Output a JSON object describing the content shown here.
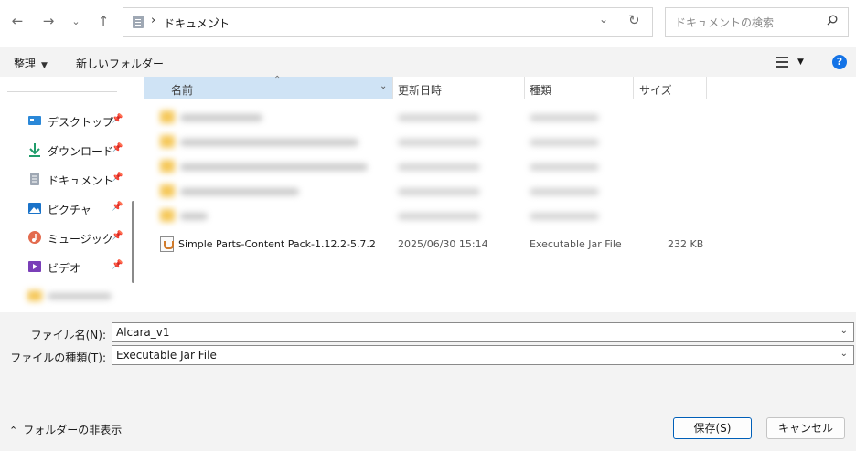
{
  "address": {
    "crumbs": [
      "ドキュメント"
    ],
    "separator": "›",
    "search_placeholder": "ドキュメントの検索"
  },
  "toolbar": {
    "organize_label": "整理",
    "new_folder_label": "新しいフォルダー",
    "help_label": "?"
  },
  "nav": {
    "items": [
      {
        "label": "デスクトップ",
        "icon": "desktop-icon"
      },
      {
        "label": "ダウンロード",
        "icon": "download-icon"
      },
      {
        "label": "ドキュメント",
        "icon": "document-icon"
      },
      {
        "label": "ピクチャ",
        "icon": "picture-icon"
      },
      {
        "label": "ミュージック",
        "icon": "music-icon"
      },
      {
        "label": "ビデオ",
        "icon": "video-icon"
      }
    ],
    "pin_glyph": "📌"
  },
  "list": {
    "columns": {
      "name": "名前",
      "date": "更新日時",
      "type": "種類",
      "size": "サイズ"
    },
    "file": {
      "name": "Simple Parts-Content Pack-1.12.2-5.7.2",
      "date": "2025/06/30 15:14",
      "type": "Executable Jar File",
      "size": "232 KB"
    }
  },
  "form": {
    "filename_label": "ファイル名(N):",
    "filename_value": "Alcara_v1",
    "filetype_label": "ファイルの種類(T):",
    "filetype_value": "Executable Jar File",
    "hide_folders_label": "フォルダーの非表示",
    "save_label": "保存(S)",
    "cancel_label": "キャンセル"
  },
  "colors": {
    "accent": "#005fb8",
    "header_selected": "#cfe3f5",
    "folder": "#f5c85a",
    "help": "#1473e6"
  }
}
